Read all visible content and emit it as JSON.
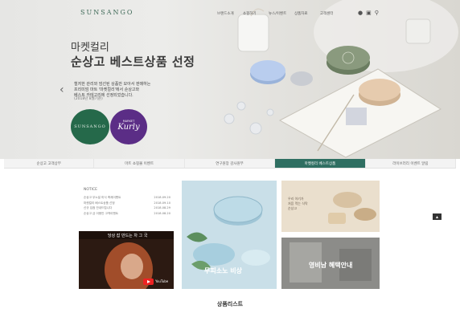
{
  "header": {
    "logo": "SUNSANGO",
    "nav": [
      "브랜드소개",
      "쇼핑하기",
      "뉴스/이벤트",
      "상품자료",
      "고객센터"
    ]
  },
  "hero": {
    "kicker": "마켓컬리",
    "title": "순상고 베스트상품 선정",
    "desc_line1": "철저한 관리와 엄선된 상품만 모아서 판매하는",
    "desc_line2": "프리미엄 마트 '마켓컬리'에서 순상고와",
    "desc_line3": "베스트 카테고리에 선정되었습니다.",
    "date": "(2018년 8월기준)",
    "badge_sunsango": "SUNSANGO",
    "badge_kurly_small": "MARKET",
    "badge_kurly_large": "Kurly"
  },
  "tabs": [
    {
      "label": "순상고 고객상부"
    },
    {
      "label": "마트 쇼핑몰 이벤트"
    },
    {
      "label": "연구원장 감사원부"
    },
    {
      "label": "마켓컬리 베스트상품"
    },
    {
      "label": "라이브러리 이벤트 알림"
    }
  ],
  "notice": {
    "title": "NOTICE",
    "rows": [
      {
        "title": "순상고 무노일 미식 축제이벤트",
        "date": "2018.09.20"
      },
      {
        "title": "마켓컬리 베스트상품 선정",
        "date": "2018.09.10"
      },
      {
        "title": "신규 입점 안내드립니다",
        "date": "2018.08.29"
      },
      {
        "title": "순상고 금 이용안 고객이벤트",
        "date": "2018.08.20"
      }
    ]
  },
  "video": {
    "caption": "당상 잡 만드는 차 그 국",
    "brand": "YouTube"
  },
  "tiles": {
    "blue": "무피소노 비상",
    "wood_line1": "우리 아기가",
    "wood_line2": "처음 먹는 식탁",
    "wood_line3": "순상고",
    "gray": "영비남 혜택안내"
  },
  "side_button": "TOP",
  "products_heading": "상품리스트",
  "colors": {
    "brand_green": "#2f6f62",
    "kurly_purple": "#5b2d86",
    "sunsango_green": "#25694a"
  }
}
